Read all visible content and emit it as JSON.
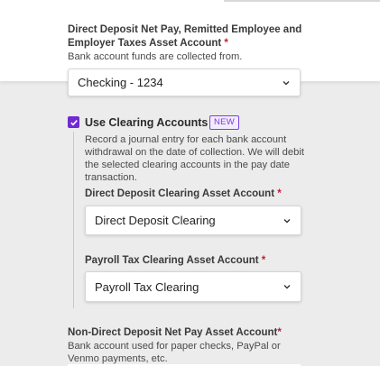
{
  "net_pay_account": {
    "label": "Direct Deposit Net Pay, Remitted Employee and Employer Taxes Asset Account",
    "required_mark": "*",
    "helper": "Bank account funds are collected from.",
    "selected": "Checking - 1234"
  },
  "clearing": {
    "checkbox_label": "Use Clearing Accounts",
    "checked": true,
    "badge": "NEW",
    "description": "Record a journal entry for each bank account withdrawal on the date of collection. We will debit the selected clearing accounts in the pay date transaction."
  },
  "dd_clearing": {
    "label": "Direct Deposit Clearing Asset Account",
    "required_mark": "*",
    "selected": "Direct Deposit Clearing"
  },
  "tax_clearing": {
    "label": "Payroll Tax Clearing Asset Account",
    "required_mark": "*",
    "selected": "Payroll Tax Clearing"
  },
  "non_dd_account": {
    "label": "Non-Direct Deposit Net Pay Asset Account",
    "required_mark": "*",
    "helper": "Bank account used for paper checks, PayPal or Venmo payments, etc."
  },
  "colors": {
    "accent": "#6f2bd1",
    "required": "#c0203a",
    "background": "#ececec"
  },
  "icons": {
    "select_chevron": "chevron-down-icon",
    "checkbox": "checkmark-icon"
  }
}
